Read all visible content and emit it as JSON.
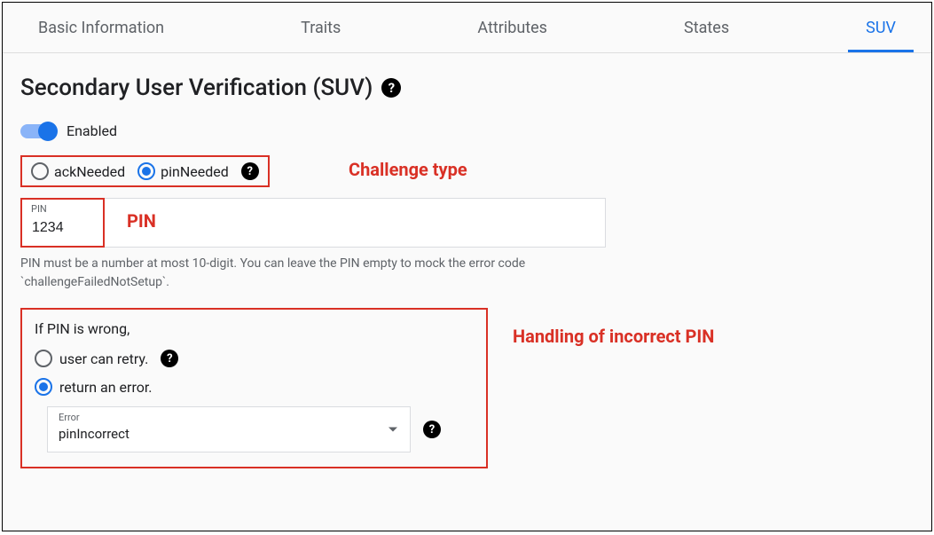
{
  "tabs": [
    {
      "label": "Basic Information",
      "active": false
    },
    {
      "label": "Traits",
      "active": false
    },
    {
      "label": "Attributes",
      "active": false
    },
    {
      "label": "States",
      "active": false
    },
    {
      "label": "SUV",
      "active": true
    }
  ],
  "page": {
    "title": "Secondary User Verification (SUV)"
  },
  "toggle": {
    "enabled_label": "Enabled",
    "state": true
  },
  "challenge": {
    "options": {
      "ack": "ackNeeded",
      "pin": "pinNeeded"
    },
    "selected": "pinNeeded"
  },
  "pin_field": {
    "float_label": "PIN",
    "value": "1234",
    "helper": "PIN must be a number at most 10-digit. You can leave the PIN empty to mock the error code `challengeFailedNotSetup`."
  },
  "error_section": {
    "heading": "If PIN is wrong,",
    "options": {
      "retry": "user can retry.",
      "return_error": "return an error."
    },
    "selected": "return an error.",
    "select": {
      "float_label": "Error",
      "value": "pinIncorrect"
    }
  },
  "annotations": {
    "challenge_type": "Challenge type",
    "pin": "PIN",
    "incorrect_pin": "Handling of incorrect PIN"
  }
}
